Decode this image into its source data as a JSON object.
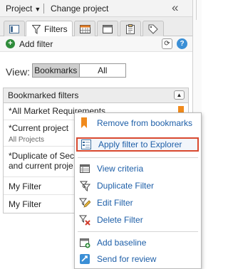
{
  "topbar": {
    "project_label": "Project",
    "change_project_label": "Change project"
  },
  "tabs": [
    {
      "name": "tab-details",
      "icon": "details-icon"
    },
    {
      "name": "tab-filters",
      "label": "Filters",
      "icon": "filter-icon"
    },
    {
      "name": "tab-calendar",
      "icon": "calendar-icon"
    },
    {
      "name": "tab-window",
      "icon": "window-icon"
    },
    {
      "name": "tab-clipboard",
      "icon": "clipboard-icon"
    },
    {
      "name": "tab-tags",
      "icon": "tag-icon"
    }
  ],
  "add_filter": {
    "label": "Add filter"
  },
  "view": {
    "label": "View:",
    "options": [
      "Bookmarks",
      "All"
    ],
    "selected": "Bookmarks"
  },
  "list": {
    "header": "Bookmarked filters",
    "items": [
      {
        "title": "*All Market Requirements"
      },
      {
        "title": "*Current project",
        "sub": "All Projects"
      },
      {
        "title": "*Duplicate of Sec",
        "title2": "and current proje"
      },
      {
        "title": "My Filter"
      },
      {
        "title": "My Filter"
      }
    ]
  },
  "context_menu": {
    "items": [
      {
        "label": "Remove from bookmarks",
        "icon": "bookmark-icon"
      },
      {
        "label": "Apply filter to Explorer",
        "icon": "explorer-icon",
        "highlighted": true
      },
      {
        "label": "View criteria",
        "icon": "grid-icon"
      },
      {
        "label": "Duplicate Filter",
        "icon": "duplicate-icon"
      },
      {
        "label": "Edit Filter",
        "icon": "edit-icon"
      },
      {
        "label": "Delete Filter",
        "icon": "delete-icon"
      },
      {
        "label": "Add baseline",
        "icon": "baseline-icon"
      },
      {
        "label": "Send for review",
        "icon": "send-review-icon"
      }
    ]
  },
  "colors": {
    "accent_link": "#1e5fa8",
    "highlight_border": "#d9492f",
    "bookmark_orange": "#f08a1c"
  }
}
